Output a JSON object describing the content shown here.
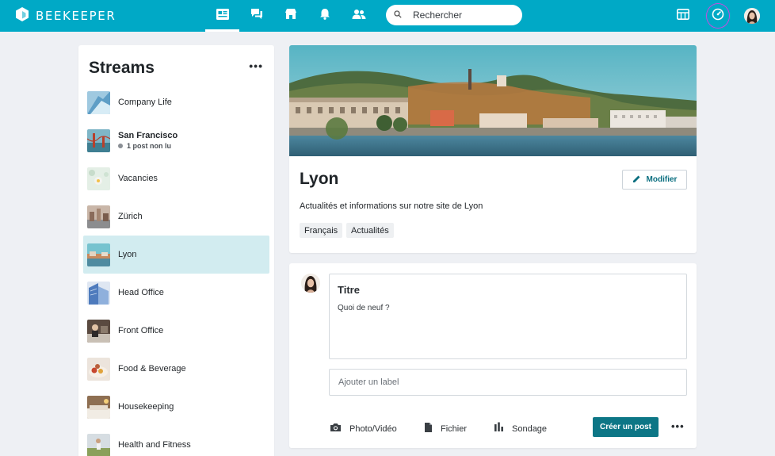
{
  "app": {
    "brand": "BEEKEEPER"
  },
  "nav": {
    "items": [
      "feed-icon",
      "chat-icon",
      "shop-icon",
      "bell-icon",
      "people-icon"
    ],
    "active": "feed-icon"
  },
  "search": {
    "placeholder": "Rechercher"
  },
  "sidebar": {
    "title": "Streams",
    "more": "•••",
    "items": [
      {
        "label": "Company Life"
      },
      {
        "label": "San Francisco",
        "sub": "1 post non lu"
      },
      {
        "label": "Vacancies"
      },
      {
        "label": "Zürich"
      },
      {
        "label": "Lyon"
      },
      {
        "label": "Head Office"
      },
      {
        "label": "Front Office"
      },
      {
        "label": "Food & Beverage"
      },
      {
        "label": "Housekeeping"
      },
      {
        "label": "Health and Fitness"
      }
    ]
  },
  "stream": {
    "title": "Lyon",
    "edit_label": "Modifier",
    "description": "Actualités et informations sur notre site de Lyon",
    "tags": [
      "Français",
      "Actualités"
    ]
  },
  "composer": {
    "title_placeholder": "Titre",
    "body_placeholder": "Quoi de neuf ?",
    "label_placeholder": "Ajouter un label",
    "actions": [
      {
        "label": "Photo/Vidéo",
        "icon": "camera-icon"
      },
      {
        "label": "Fichier",
        "icon": "file-icon"
      },
      {
        "label": "Sondage",
        "icon": "poll-icon"
      }
    ],
    "create_label": "Créer un post",
    "more": "•••"
  },
  "colors": {
    "topbar": "#00a9c6",
    "accent": "#0d7686",
    "active_stream": "#d2ecf0"
  }
}
